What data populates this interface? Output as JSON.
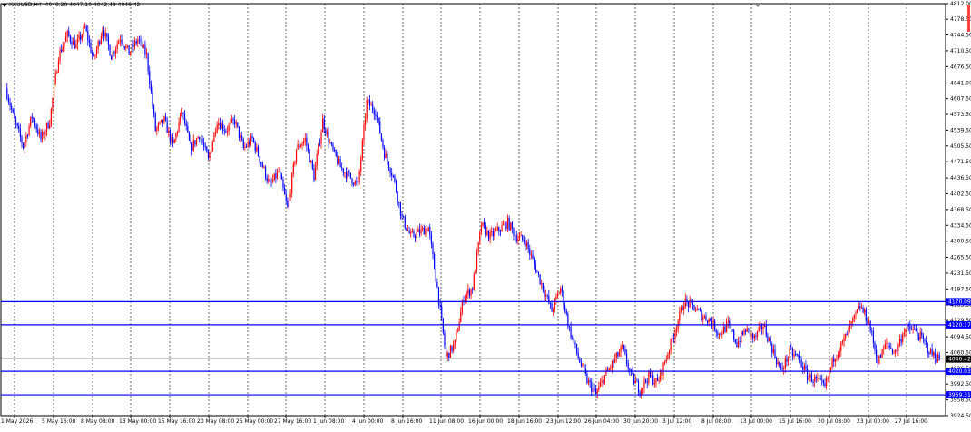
{
  "header": {
    "symbol": "XAUUSD,H4",
    "ohlc": "4040.20 4047.10 4042.49 4046.42"
  },
  "chart_data": {
    "type": "candlestick",
    "title": "",
    "price_ticks": [
      "4812.00",
      "4778.50",
      "4744.50",
      "4710.50",
      "4676.50",
      "4641.00",
      "4607.50",
      "4573.50",
      "4539.50",
      "4505.50",
      "4471.50",
      "4436.50",
      "4402.50",
      "4368.50",
      "4334.50",
      "4300.50",
      "4265.50",
      "4231.50",
      "4197.50",
      "4163.00",
      "4129.50",
      "4094.50",
      "4060.50",
      "4026.50",
      "3992.50",
      "3958.50",
      "3924.50"
    ],
    "ylim": [
      3924.5,
      4812.0
    ],
    "time_labels": [
      "1 May 2026",
      "5 May 16:00",
      "8 May 08:00",
      "13 May 00:00",
      "15 May 16:00",
      "20 May 08:00",
      "25 May 00:00",
      "27 May 16:00",
      "1 Jun 08:00",
      "4 Jun 00:00",
      "8 Jun 16:00",
      "11 Jun 08:00",
      "16 Jun 00:00",
      "18 Jun 16:00",
      "23 Jun 12:00",
      "26 Jun 04:00",
      "30 Jun 20:00",
      "3 Jul 12:00",
      "8 Jul 08:00",
      "13 Jul 00:00",
      "15 Jul 16:00",
      "20 Jul 08:00",
      "23 Jul 00:00",
      "27 Jul 16:00"
    ],
    "horizontal_levels": [
      {
        "price": 4170.09,
        "label": "4170.09"
      },
      {
        "price": 4120.17,
        "label": "4120.17"
      },
      {
        "price": 4020.03,
        "label": "4020.03"
      },
      {
        "price": 3969.31,
        "label": "3969.31"
      }
    ],
    "current_price": {
      "price": 4046.42,
      "label": "4046.42"
    },
    "path": [
      4630,
      4560,
      4505,
      4570,
      4520,
      4560,
      4700,
      4745,
      4720,
      4760,
      4690,
      4760,
      4700,
      4740,
      4705,
      4735,
      4700,
      4540,
      4560,
      4505,
      4580,
      4500,
      4530,
      4475,
      4560,
      4540,
      4560,
      4500,
      4520,
      4470,
      4420,
      4450,
      4370,
      4500,
      4520,
      4440,
      4560,
      4500,
      4460,
      4440,
      4420,
      4600,
      4580,
      4490,
      4440,
      4350,
      4310,
      4320,
      4330,
      4200,
      4050,
      4080,
      4180,
      4200,
      4335,
      4310,
      4325,
      4340,
      4310,
      4300,
      4250,
      4200,
      4150,
      4200,
      4110,
      4050,
      4000,
      3970,
      4010,
      4040,
      4070,
      4010,
      3980,
      4010,
      3995,
      4050,
      4110,
      4170,
      4160,
      4140,
      4130,
      4100,
      4120,
      4080,
      4110,
      4090,
      4120,
      4070,
      4020,
      4060,
      4050,
      4010,
      4000,
      3985,
      4050,
      4080,
      4120,
      4160,
      4125,
      4040,
      4080,
      4060,
      4110,
      4110,
      4090,
      4060,
      4046
    ]
  },
  "colors": {
    "bull": "#ff0000",
    "bear": "#0000ff",
    "level": "#0000ff",
    "grid": "#000000",
    "label_bg": "#0000ff",
    "current_bg": "#000000"
  }
}
